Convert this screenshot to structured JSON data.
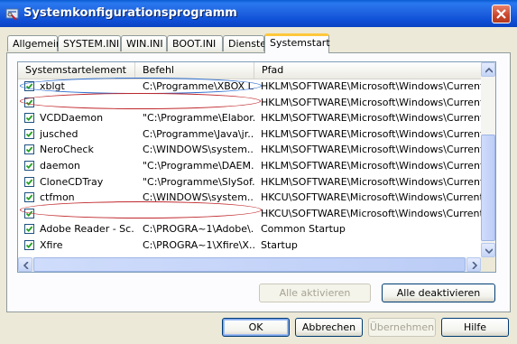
{
  "window": {
    "title": "Systemkonfigurationsprogramm"
  },
  "tabs": [
    {
      "label": "Allgemein",
      "active": false
    },
    {
      "label": "SYSTEM.INI",
      "active": false
    },
    {
      "label": "WIN.INI",
      "active": false
    },
    {
      "label": "BOOT.INI",
      "active": false
    },
    {
      "label": "Dienste",
      "active": false
    },
    {
      "label": "Systemstart",
      "active": true
    }
  ],
  "list": {
    "columns": [
      "Systemstartelement",
      "Befehl",
      "Pfad"
    ],
    "rows": [
      {
        "checked": true,
        "name": "xblgt",
        "command": "C:\\Programme\\XBOX L...",
        "path": "HKLM\\SOFTWARE\\Microsoft\\Windows\\CurrentVer..."
      },
      {
        "checked": true,
        "name": "",
        "command": "",
        "path": "HKLM\\SOFTWARE\\Microsoft\\Windows\\CurrentVer..."
      },
      {
        "checked": true,
        "name": "VCDDaemon",
        "command": "\"C:\\Programme\\Elabor...",
        "path": "HKLM\\SOFTWARE\\Microsoft\\Windows\\CurrentVer..."
      },
      {
        "checked": true,
        "name": "jusched",
        "command": "C:\\Programme\\Java\\jr...",
        "path": "HKLM\\SOFTWARE\\Microsoft\\Windows\\CurrentVer..."
      },
      {
        "checked": true,
        "name": "NeroCheck",
        "command": "C:\\WINDOWS\\system...",
        "path": "HKLM\\SOFTWARE\\Microsoft\\Windows\\CurrentVer..."
      },
      {
        "checked": true,
        "name": "daemon",
        "command": "\"C:\\Programme\\DAEM...",
        "path": "HKLM\\SOFTWARE\\Microsoft\\Windows\\CurrentVer..."
      },
      {
        "checked": true,
        "name": "CloneCDTray",
        "command": "\"C:\\Programme\\SlySof...",
        "path": "HKLM\\SOFTWARE\\Microsoft\\Windows\\CurrentVer..."
      },
      {
        "checked": true,
        "name": "ctfmon",
        "command": "C:\\WINDOWS\\system...",
        "path": "HKCU\\SOFTWARE\\Microsoft\\Windows\\CurrentVer..."
      },
      {
        "checked": true,
        "name": "",
        "command": "",
        "path": "HKCU\\SOFTWARE\\Microsoft\\Windows\\CurrentVer..."
      },
      {
        "checked": true,
        "name": "Adobe Reader - Sc...",
        "command": "C:\\PROGRA~1\\Adobe\\...",
        "path": "Common Startup"
      },
      {
        "checked": true,
        "name": "Xfire",
        "command": "C:\\PROGRA~1\\Xfire\\X...",
        "path": "Startup"
      }
    ]
  },
  "annotations": {
    "blue_ellipse_color": "#2f6fd0",
    "red_ellipse_color": "#c0282c"
  },
  "buttons": {
    "enable_all": "Alle aktivieren",
    "disable_all": "Alle deaktivieren",
    "ok": "OK",
    "cancel": "Abbrechen",
    "apply": "Übernehmen",
    "help": "Hilfe"
  },
  "icons": {
    "title_icon": "settings-app-icon",
    "close": "close-icon",
    "check": "checkmark-icon"
  }
}
